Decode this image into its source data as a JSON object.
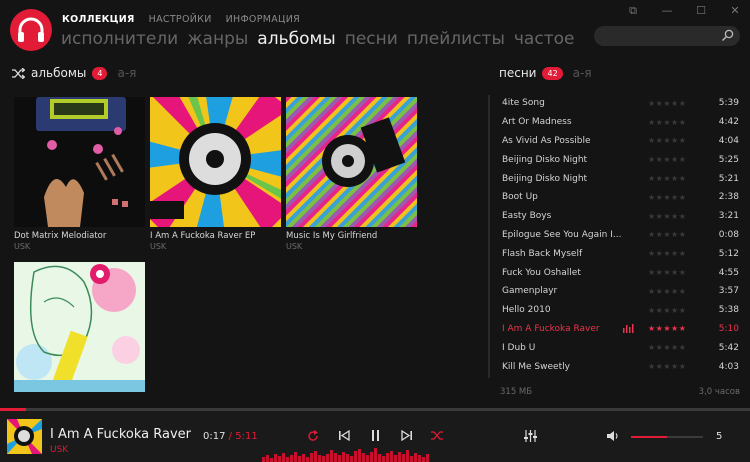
{
  "nav": {
    "top": [
      "КОЛЛЕКЦИЯ",
      "НАСТРОЙКИ",
      "ИНФОРМАЦИЯ"
    ],
    "sub": [
      "исполнители",
      "жанры",
      "альбомы",
      "песни",
      "плейлисты",
      "частое"
    ]
  },
  "albums_section": {
    "title": "альбомы",
    "count": "4",
    "sort": "а-я"
  },
  "albums": [
    {
      "title": "Dot Matrix Melodiator",
      "artist": "USK"
    },
    {
      "title": "I Am A Fuckoka Raver EP",
      "artist": "USK"
    },
    {
      "title": "Music Is My Girlfriend",
      "artist": "USK"
    },
    {
      "title": "",
      "artist": ""
    }
  ],
  "songs_section": {
    "title": "песни",
    "count": "42",
    "sort": "а-я"
  },
  "songs": [
    {
      "name": "4ite Song",
      "dur": "5:39"
    },
    {
      "name": "Art Or Madness",
      "dur": "4:42"
    },
    {
      "name": "As Vivid As Possible",
      "dur": "4:04"
    },
    {
      "name": "Beijing Disko Night",
      "dur": "5:25"
    },
    {
      "name": "Beijing Disko Night",
      "dur": "5:21"
    },
    {
      "name": "Boot Up",
      "dur": "2:38"
    },
    {
      "name": "Easty Boys",
      "dur": "3:21"
    },
    {
      "name": "Epilogue See You Again I...",
      "dur": "0:08"
    },
    {
      "name": "Flash Back Myself",
      "dur": "5:12"
    },
    {
      "name": "Fuck You Oshallet",
      "dur": "4:55"
    },
    {
      "name": "Gamenplayr",
      "dur": "3:57"
    },
    {
      "name": "Hello 2010",
      "dur": "5:38"
    },
    {
      "name": "I Am A Fuckoka Raver",
      "dur": "5:10",
      "active": true,
      "rating": 5
    },
    {
      "name": "I Dub U",
      "dur": "5:42"
    },
    {
      "name": "Kill Me Sweetly",
      "dur": "4:03"
    }
  ],
  "songs_footer": {
    "size": "315 МБ",
    "duration": "3,0 часов"
  },
  "player": {
    "title": "I Am A Fuckoka Raver",
    "artist": "USK",
    "elapsed": "0:17",
    "separator": "/",
    "total": "5:11",
    "progress": 0.034,
    "volume": "5",
    "volume_level": 0.5
  },
  "colors": {
    "accent": "#e21b36",
    "background": "#141414"
  }
}
